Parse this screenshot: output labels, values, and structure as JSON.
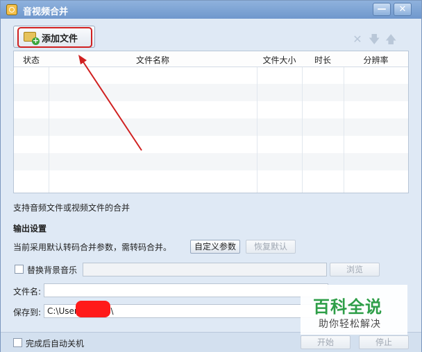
{
  "window": {
    "title": "音视频合并",
    "minimize": "—",
    "close": "✕"
  },
  "toolbar": {
    "add_file_label": "添加文件",
    "icons": {
      "remove": "✕",
      "move_down": "🡇",
      "move_up": "🡅"
    }
  },
  "table": {
    "columns": [
      "状态",
      "文件名称",
      "文件大小",
      "时长",
      "分辨率"
    ],
    "rows": []
  },
  "hint": "支持音频文件或视频文件的合并",
  "output": {
    "section_title": "输出设置",
    "param_text": "当前采用默认转码合并参数，需转码合并。",
    "custom_params_label": "自定义参数",
    "restore_default_label": "恢复默认",
    "bg_music_label": "替换背景音乐",
    "bg_music_value": "",
    "browse_label": "浏览",
    "filename_label": "文件名:",
    "filename_value": "",
    "saveto_label": "保存到:",
    "saveto_value": "C:\\User          \\Videos\\"
  },
  "footer": {
    "auto_shutdown_label": "完成后自动关机",
    "start_label": "开始",
    "stop_label": "停止"
  },
  "watermark": {
    "title": "百科全说",
    "subtitle": "助你轻松解决"
  },
  "colors": {
    "title_bar": "#7aa0d2",
    "annotation_red": "#d02020",
    "watermark_green": "#2e9e48"
  }
}
